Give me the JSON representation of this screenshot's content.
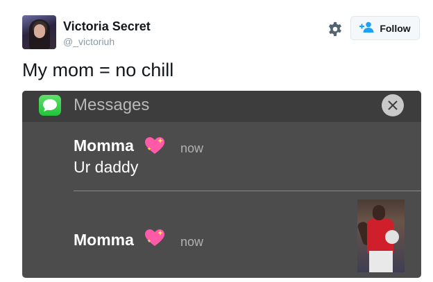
{
  "tweet": {
    "user": {
      "display_name": "Victoria Secret",
      "handle": "@_victoriuh",
      "avatar": "avatar-photo"
    },
    "follow_label": "Follow",
    "text": "My mom = no chill"
  },
  "icons": {
    "settings": "gear-icon",
    "follow": "add-user-icon",
    "messages": "speech-bubble-icon",
    "close": "close-icon",
    "emoji": "sparkling-heart"
  },
  "notification": {
    "app_name": "Messages",
    "messages": [
      {
        "sender": "Momma",
        "time": "now",
        "text": "Ur daddy"
      },
      {
        "sender": "Momma",
        "time": "now",
        "text": ""
      }
    ]
  },
  "colors": {
    "handle": "#8899a6",
    "follow_accent": "#1da1f2",
    "messages_green": "#22c33b",
    "heart": "#ff5aa8"
  }
}
